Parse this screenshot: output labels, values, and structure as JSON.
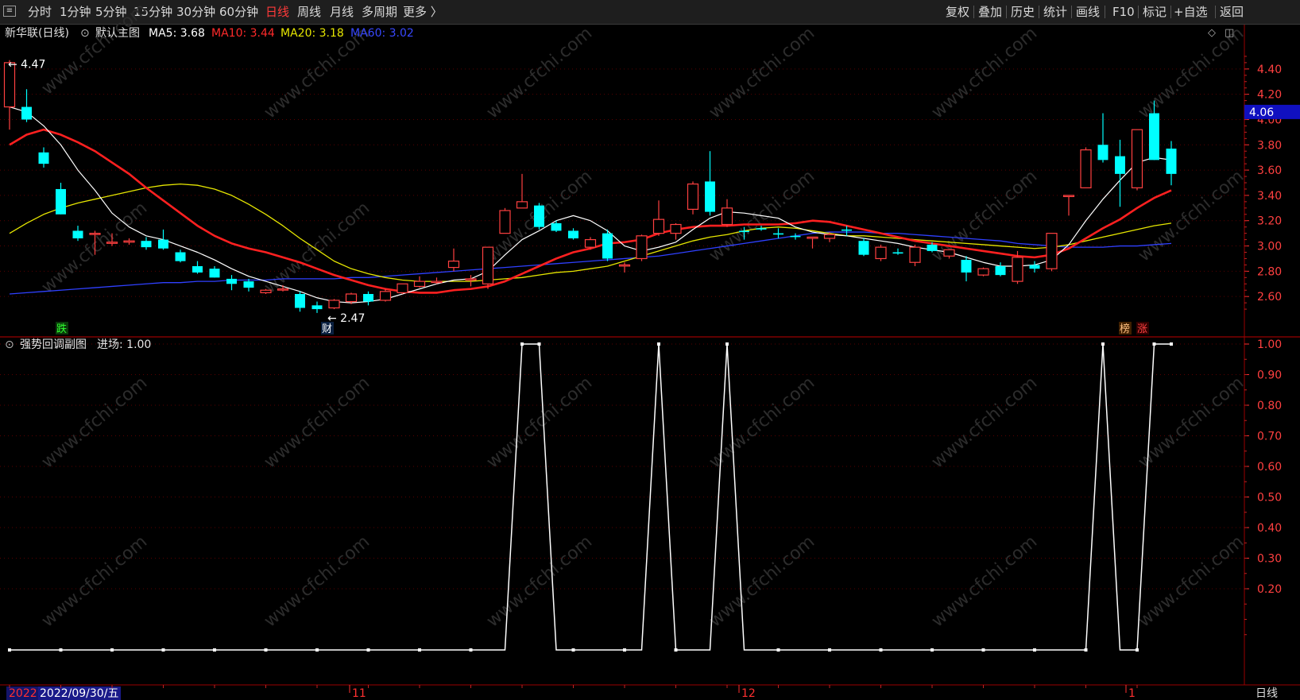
{
  "toolbar": {
    "left": [
      "分时",
      "1分钟",
      "5分钟",
      "15分钟",
      "30分钟",
      "60分钟",
      "日线",
      "周线",
      "月线",
      "多周期",
      "更多 〉"
    ],
    "active": "日线",
    "right": [
      "复权",
      "叠加",
      "历史",
      "统计",
      "画线",
      "F10",
      "标记",
      "+自选",
      "返回"
    ]
  },
  "main_legend": {
    "stock": "新华联(日线)",
    "template": "默认主图",
    "ma5": "MA5: 3.68",
    "ma10": "MA10: 3.44",
    "ma20": "MA20: 3.18",
    "ma60": "MA60: 3.02"
  },
  "sub_legend": {
    "name": "强势回调副图",
    "value": "进场: 1.00"
  },
  "colors": {
    "bg": "#000000",
    "grid": "#7a0000",
    "up": "#ff4040",
    "down": "#00ffff",
    "ma5": "#ffffff",
    "ma10": "#ff2020",
    "ma20": "#e6e600",
    "ma60": "#2f40ff",
    "axis_text": "#ff4040"
  },
  "price_axis": {
    "ticks": [
      "4.40",
      "4.20",
      "4.00",
      "3.80",
      "3.60",
      "3.40",
      "3.20",
      "3.00",
      "2.80",
      "2.60"
    ],
    "current": "4.06"
  },
  "sub_axis": {
    "ticks": [
      "1.00",
      "0.90",
      "0.80",
      "0.70",
      "0.60",
      "0.50",
      "0.40",
      "0.30",
      "0.20"
    ]
  },
  "annotations": {
    "high": "4.47",
    "low": "2.47",
    "die": "跌",
    "cai": "财",
    "bang": "榜",
    "zhang": "涨"
  },
  "date_axis": {
    "year": "2022",
    "date": "2022/09/30/五",
    "months": [
      "11",
      "12",
      "1"
    ],
    "period": "日线"
  },
  "chart_data": {
    "type": "candlestick",
    "ylim": [
      2.4,
      4.6
    ],
    "candles": [
      {
        "o": 4.1,
        "h": 4.47,
        "l": 3.92,
        "c": 4.45
      },
      {
        "o": 4.1,
        "h": 4.24,
        "l": 3.98,
        "c": 4.0
      },
      {
        "o": 3.74,
        "h": 3.78,
        "l": 3.62,
        "c": 3.65
      },
      {
        "o": 3.45,
        "h": 3.5,
        "l": 3.25,
        "c": 3.25
      },
      {
        "o": 3.12,
        "h": 3.16,
        "l": 3.04,
        "c": 3.06
      },
      {
        "o": 3.1,
        "h": 3.12,
        "l": 2.93,
        "c": 3.1
      },
      {
        "o": 3.03,
        "h": 3.1,
        "l": 3.0,
        "c": 3.03
      },
      {
        "o": 3.03,
        "h": 3.06,
        "l": 3.01,
        "c": 3.04
      },
      {
        "o": 3.04,
        "h": 3.07,
        "l": 2.97,
        "c": 2.99
      },
      {
        "o": 3.05,
        "h": 3.13,
        "l": 2.97,
        "c": 2.98
      },
      {
        "o": 2.95,
        "h": 2.97,
        "l": 2.87,
        "c": 2.88
      },
      {
        "o": 2.84,
        "h": 2.88,
        "l": 2.78,
        "c": 2.79
      },
      {
        "o": 2.82,
        "h": 2.84,
        "l": 2.75,
        "c": 2.75
      },
      {
        "o": 2.74,
        "h": 2.77,
        "l": 2.65,
        "c": 2.7
      },
      {
        "o": 2.72,
        "h": 2.74,
        "l": 2.64,
        "c": 2.67
      },
      {
        "o": 2.63,
        "h": 2.66,
        "l": 2.62,
        "c": 2.65
      },
      {
        "o": 2.66,
        "h": 2.69,
        "l": 2.64,
        "c": 2.66
      },
      {
        "o": 2.62,
        "h": 2.64,
        "l": 2.48,
        "c": 2.51
      },
      {
        "o": 2.53,
        "h": 2.56,
        "l": 2.47,
        "c": 2.5
      },
      {
        "o": 2.51,
        "h": 2.58,
        "l": 2.5,
        "c": 2.57
      },
      {
        "o": 2.56,
        "h": 2.63,
        "l": 2.54,
        "c": 2.62
      },
      {
        "o": 2.62,
        "h": 2.64,
        "l": 2.53,
        "c": 2.56
      },
      {
        "o": 2.57,
        "h": 2.66,
        "l": 2.56,
        "c": 2.64
      },
      {
        "o": 2.63,
        "h": 2.7,
        "l": 2.62,
        "c": 2.7
      },
      {
        "o": 2.68,
        "h": 2.76,
        "l": 2.67,
        "c": 2.72
      },
      {
        "o": 2.72,
        "h": 2.75,
        "l": 2.7,
        "c": 2.72
      },
      {
        "o": 2.83,
        "h": 2.98,
        "l": 2.8,
        "c": 2.88
      },
      {
        "o": 2.73,
        "h": 2.77,
        "l": 2.68,
        "c": 2.74
      },
      {
        "o": 2.7,
        "h": 2.99,
        "l": 2.66,
        "c": 2.99
      },
      {
        "o": 3.1,
        "h": 3.3,
        "l": 3.1,
        "c": 3.28
      },
      {
        "o": 3.3,
        "h": 3.57,
        "l": 3.3,
        "c": 3.35
      },
      {
        "o": 3.32,
        "h": 3.34,
        "l": 3.13,
        "c": 3.15
      },
      {
        "o": 3.18,
        "h": 3.2,
        "l": 3.11,
        "c": 3.12
      },
      {
        "o": 3.12,
        "h": 3.14,
        "l": 3.05,
        "c": 3.06
      },
      {
        "o": 2.99,
        "h": 3.07,
        "l": 2.97,
        "c": 3.05
      },
      {
        "o": 3.1,
        "h": 3.13,
        "l": 2.88,
        "c": 2.9
      },
      {
        "o": 2.85,
        "h": 2.87,
        "l": 2.79,
        "c": 2.85
      },
      {
        "o": 2.9,
        "h": 3.09,
        "l": 2.88,
        "c": 3.08
      },
      {
        "o": 3.1,
        "h": 3.36,
        "l": 3.08,
        "c": 3.21
      },
      {
        "o": 3.1,
        "h": 3.18,
        "l": 3.05,
        "c": 3.17
      },
      {
        "o": 3.29,
        "h": 3.51,
        "l": 3.25,
        "c": 3.49
      },
      {
        "o": 3.51,
        "h": 3.75,
        "l": 3.24,
        "c": 3.27
      },
      {
        "o": 3.17,
        "h": 3.37,
        "l": 3.15,
        "c": 3.3
      },
      {
        "o": 3.12,
        "h": 3.15,
        "l": 3.05,
        "c": 3.11
      },
      {
        "o": 3.14,
        "h": 3.16,
        "l": 3.12,
        "c": 3.13
      },
      {
        "o": 3.1,
        "h": 3.14,
        "l": 3.06,
        "c": 3.09
      },
      {
        "o": 3.08,
        "h": 3.1,
        "l": 3.05,
        "c": 3.07
      },
      {
        "o": 3.06,
        "h": 3.07,
        "l": 2.98,
        "c": 3.07
      },
      {
        "o": 3.06,
        "h": 3.11,
        "l": 3.03,
        "c": 3.09
      },
      {
        "o": 3.13,
        "h": 3.16,
        "l": 3.08,
        "c": 3.12
      },
      {
        "o": 3.04,
        "h": 3.06,
        "l": 2.92,
        "c": 2.93
      },
      {
        "o": 2.9,
        "h": 3.01,
        "l": 2.88,
        "c": 2.99
      },
      {
        "o": 2.95,
        "h": 2.98,
        "l": 2.93,
        "c": 2.94
      },
      {
        "o": 2.87,
        "h": 3.01,
        "l": 2.84,
        "c": 2.99
      },
      {
        "o": 3.01,
        "h": 3.03,
        "l": 2.95,
        "c": 2.96
      },
      {
        "o": 2.92,
        "h": 2.97,
        "l": 2.9,
        "c": 2.97
      },
      {
        "o": 2.89,
        "h": 2.92,
        "l": 2.72,
        "c": 2.79
      },
      {
        "o": 2.77,
        "h": 2.83,
        "l": 2.76,
        "c": 2.82
      },
      {
        "o": 2.84,
        "h": 2.87,
        "l": 2.76,
        "c": 2.77
      },
      {
        "o": 2.72,
        "h": 2.96,
        "l": 2.7,
        "c": 2.91
      },
      {
        "o": 2.85,
        "h": 2.88,
        "l": 2.79,
        "c": 2.82
      },
      {
        "o": 2.82,
        "h": 3.1,
        "l": 2.8,
        "c": 3.1
      },
      {
        "o": 3.4,
        "h": 3.4,
        "l": 3.24,
        "c": 3.4
      },
      {
        "o": 3.46,
        "h": 3.78,
        "l": 3.46,
        "c": 3.76
      },
      {
        "o": 3.8,
        "h": 4.05,
        "l": 3.66,
        "c": 3.68
      },
      {
        "o": 3.71,
        "h": 3.84,
        "l": 3.31,
        "c": 3.57
      },
      {
        "o": 3.46,
        "h": 3.92,
        "l": 3.44,
        "c": 3.92
      },
      {
        "o": 4.05,
        "h": 4.15,
        "l": 3.68,
        "c": 3.68
      },
      {
        "o": 3.77,
        "h": 3.83,
        "l": 3.48,
        "c": 3.57
      }
    ],
    "ma5": [
      4.1,
      4.06,
      3.95,
      3.8,
      3.6,
      3.44,
      3.26,
      3.15,
      3.08,
      3.05,
      3.0,
      2.95,
      2.89,
      2.82,
      2.76,
      2.72,
      2.68,
      2.64,
      2.59,
      2.56,
      2.55,
      2.56,
      2.58,
      2.62,
      2.66,
      2.7,
      2.73,
      2.74,
      2.8,
      2.93,
      3.05,
      3.12,
      3.2,
      3.24,
      3.2,
      3.12,
      3.0,
      2.96,
      2.99,
      3.03,
      3.13,
      3.22,
      3.27,
      3.26,
      3.24,
      3.22,
      3.15,
      3.11,
      3.09,
      3.08,
      3.06,
      3.04,
      3.02,
      2.99,
      2.97,
      2.95,
      2.91,
      2.87,
      2.84,
      2.84,
      2.85,
      2.89,
      3.01,
      3.2,
      3.37,
      3.52,
      3.66,
      3.7,
      3.68
    ],
    "ma10": [
      3.8,
      3.88,
      3.92,
      3.88,
      3.82,
      3.75,
      3.66,
      3.57,
      3.46,
      3.36,
      3.26,
      3.16,
      3.08,
      3.02,
      2.98,
      2.95,
      2.91,
      2.87,
      2.82,
      2.77,
      2.73,
      2.69,
      2.66,
      2.64,
      2.63,
      2.63,
      2.65,
      2.66,
      2.68,
      2.72,
      2.78,
      2.84,
      2.9,
      2.95,
      2.98,
      3.02,
      3.03,
      3.05,
      3.1,
      3.13,
      3.15,
      3.16,
      3.16,
      3.17,
      3.17,
      3.17,
      3.18,
      3.2,
      3.19,
      3.16,
      3.13,
      3.1,
      3.07,
      3.04,
      3.02,
      3.0,
      2.98,
      2.96,
      2.94,
      2.92,
      2.91,
      2.93,
      2.98,
      3.06,
      3.14,
      3.21,
      3.3,
      3.38,
      3.44
    ],
    "ma20": [
      3.1,
      3.18,
      3.25,
      3.3,
      3.34,
      3.37,
      3.4,
      3.43,
      3.46,
      3.48,
      3.49,
      3.48,
      3.45,
      3.4,
      3.33,
      3.25,
      3.16,
      3.06,
      2.97,
      2.88,
      2.82,
      2.78,
      2.75,
      2.73,
      2.72,
      2.72,
      2.72,
      2.72,
      2.73,
      2.74,
      2.75,
      2.77,
      2.79,
      2.8,
      2.82,
      2.84,
      2.88,
      2.92,
      2.96,
      3.0,
      3.04,
      3.07,
      3.09,
      3.12,
      3.14,
      3.15,
      3.14,
      3.12,
      3.1,
      3.08,
      3.08,
      3.07,
      3.06,
      3.05,
      3.04,
      3.03,
      3.02,
      3.01,
      3.0,
      2.99,
      2.98,
      2.99,
      3.01,
      3.04,
      3.07,
      3.1,
      3.13,
      3.16,
      3.18
    ],
    "ma60": [
      2.62,
      2.63,
      2.64,
      2.65,
      2.66,
      2.67,
      2.68,
      2.69,
      2.7,
      2.71,
      2.71,
      2.72,
      2.72,
      2.73,
      2.73,
      2.73,
      2.74,
      2.74,
      2.74,
      2.74,
      2.75,
      2.75,
      2.76,
      2.77,
      2.78,
      2.79,
      2.8,
      2.81,
      2.82,
      2.83,
      2.84,
      2.85,
      2.86,
      2.87,
      2.88,
      2.89,
      2.9,
      2.91,
      2.92,
      2.94,
      2.96,
      2.98,
      3.0,
      3.02,
      3.04,
      3.06,
      3.08,
      3.1,
      3.11,
      3.11,
      3.11,
      3.1,
      3.1,
      3.09,
      3.08,
      3.07,
      3.06,
      3.05,
      3.04,
      3.02,
      3.01,
      3.0,
      2.99,
      2.99,
      2.99,
      3.0,
      3.0,
      3.01,
      3.02
    ],
    "signal": [
      0,
      0,
      0,
      0,
      0,
      0,
      0,
      0,
      0,
      0,
      0,
      0,
      0,
      0,
      0,
      0,
      0,
      0,
      0,
      0,
      0,
      0,
      0,
      0,
      0,
      0,
      0,
      0,
      0,
      0,
      1,
      1,
      0,
      0,
      0,
      0,
      0,
      0,
      1,
      0,
      0,
      0,
      1,
      0,
      0,
      0,
      0,
      0,
      0,
      0,
      0,
      0,
      0,
      0,
      0,
      0,
      0,
      0,
      0,
      0,
      0,
      0,
      0,
      0,
      1,
      0,
      0,
      1,
      1
    ],
    "sub_ylim": [
      0,
      1
    ]
  }
}
